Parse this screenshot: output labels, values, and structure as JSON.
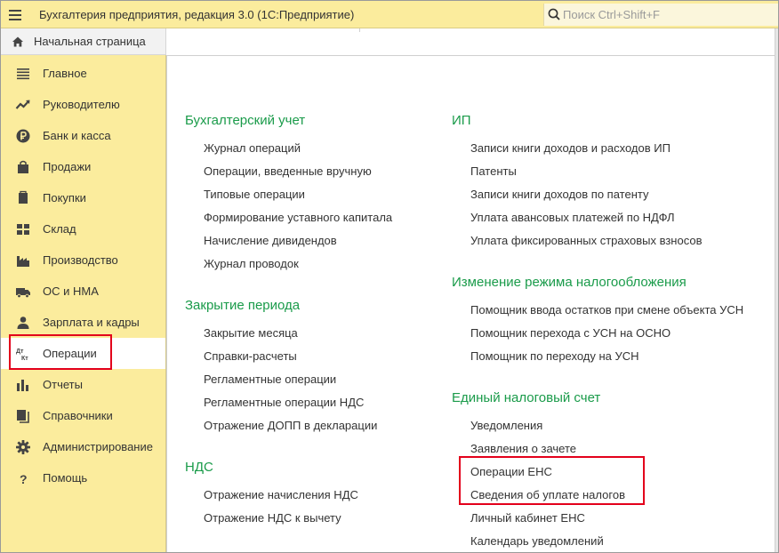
{
  "app": {
    "title": "Бухгалтерия предприятия, редакция 3.0  (1С:Предприятие)"
  },
  "search": {
    "placeholder": "Поиск Ctrl+Shift+F"
  },
  "home_tab": {
    "label": "Начальная страница"
  },
  "sidebar": {
    "items": [
      {
        "label": "Главное",
        "icon": "list-icon"
      },
      {
        "label": "Руководителю",
        "icon": "trend-icon"
      },
      {
        "label": "Банк и касса",
        "icon": "ruble-coin-icon"
      },
      {
        "label": "Продажи",
        "icon": "shopping-bag-icon"
      },
      {
        "label": "Покупки",
        "icon": "shopping-cart-icon"
      },
      {
        "label": "Склад",
        "icon": "warehouse-icon"
      },
      {
        "label": "Производство",
        "icon": "factory-icon"
      },
      {
        "label": "ОС и НМА",
        "icon": "truck-icon"
      },
      {
        "label": "Зарплата и кадры",
        "icon": "person-icon"
      },
      {
        "label": "Операции",
        "icon": "debit-credit-icon",
        "active": true
      },
      {
        "label": "Отчеты",
        "icon": "bar-chart-icon"
      },
      {
        "label": "Справочники",
        "icon": "books-icon"
      },
      {
        "label": "Администрирование",
        "icon": "gear-icon"
      },
      {
        "label": "Помощь",
        "icon": "question-icon"
      }
    ]
  },
  "sections": {
    "accounting": {
      "title": "Бухгалтерский учет",
      "links": [
        "Журнал операций",
        "Операции, введенные вручную",
        "Типовые операции",
        "Формирование уставного капитала",
        "Начисление дивидендов",
        "Журнал проводок"
      ]
    },
    "closing": {
      "title": "Закрытие периода",
      "links": [
        "Закрытие месяца",
        "Справки-расчеты",
        "Регламентные операции",
        "Регламентные операции НДС",
        "Отражение ДОПП в декларации"
      ]
    },
    "vat": {
      "title": "НДС",
      "links": [
        "Отражение начисления НДС",
        "Отражение НДС к вычету"
      ]
    },
    "ip": {
      "title": "ИП",
      "links": [
        "Записи книги доходов и расходов ИП",
        "Патенты",
        "Записи книги доходов по патенту",
        "Уплата авансовых платежей по НДФЛ",
        "Уплата фиксированных страховых взносов"
      ]
    },
    "tax_regime": {
      "title": "Изменение режима налогообложения",
      "links": [
        "Помощник ввода остатков при смене объекта УСН",
        "Помощник перехода с УСН на ОСНО",
        "Помощник по переходу на УСН"
      ]
    },
    "ens": {
      "title": "Единый налоговый счет",
      "links": [
        "Уведомления",
        "Заявления о зачете",
        "Операции ЕНС",
        "Сведения об уплате налогов",
        "Личный кабинет ЕНС",
        "Календарь уведомлений"
      ]
    }
  },
  "colors": {
    "panel_yellow": "#fbec9d",
    "section_green": "#1a9b4a",
    "highlight_red": "#e3001b"
  }
}
